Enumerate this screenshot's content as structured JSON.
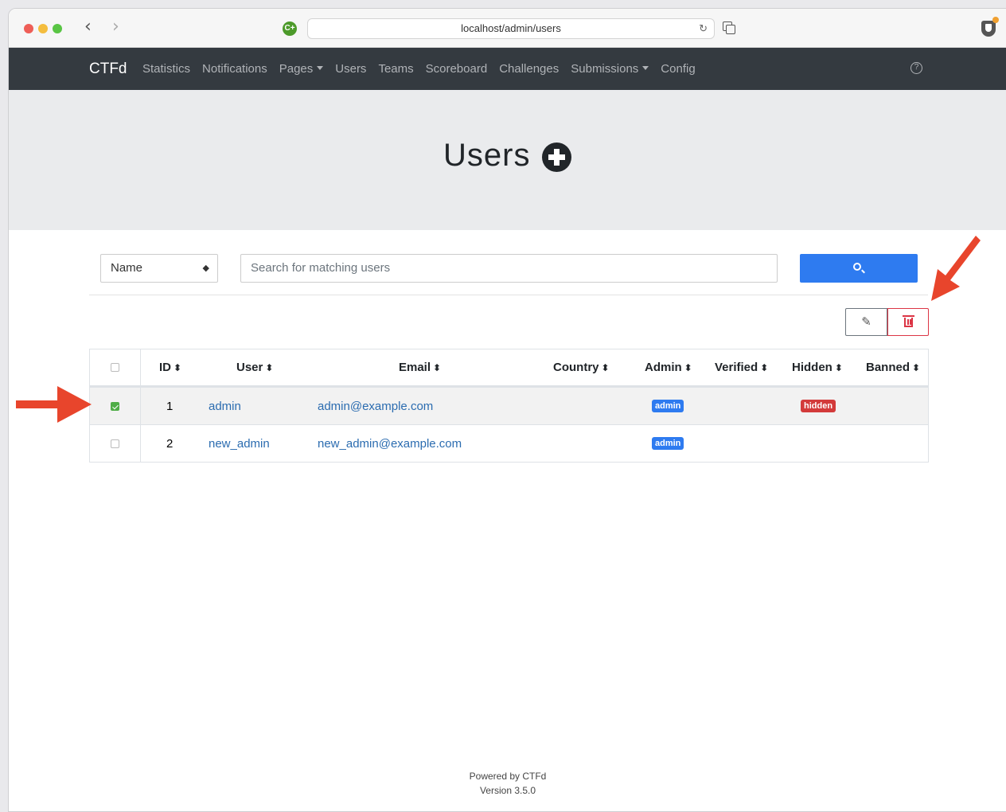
{
  "browser": {
    "url": "localhost/admin/users",
    "extension_label": "C+"
  },
  "navbar": {
    "brand": "CTFd",
    "items": [
      {
        "label": "Statistics"
      },
      {
        "label": "Notifications"
      },
      {
        "label": "Pages",
        "dropdown": true
      },
      {
        "label": "Users"
      },
      {
        "label": "Teams"
      },
      {
        "label": "Scoreboard"
      },
      {
        "label": "Challenges"
      },
      {
        "label": "Submissions",
        "dropdown": true
      },
      {
        "label": "Config"
      }
    ],
    "help_label": "?"
  },
  "page": {
    "title": "Users"
  },
  "search": {
    "field_selected": "Name",
    "placeholder": "Search for matching users"
  },
  "table": {
    "columns": [
      "ID",
      "User",
      "Email",
      "Country",
      "Admin",
      "Verified",
      "Hidden",
      "Banned"
    ],
    "rows": [
      {
        "checked": true,
        "id": "1",
        "user": "admin",
        "email": "admin@example.com",
        "country": "",
        "admin": "admin",
        "verified": "",
        "hidden": "hidden",
        "banned": ""
      },
      {
        "checked": false,
        "id": "2",
        "user": "new_admin",
        "email": "new_admin@example.com",
        "country": "",
        "admin": "admin",
        "verified": "",
        "hidden": "",
        "banned": ""
      }
    ]
  },
  "footer": {
    "line1": "Powered by CTFd",
    "line2": "Version 3.5.0"
  },
  "colors": {
    "navbar_bg": "#343a40",
    "primary": "#2e7bf0",
    "danger": "#dc3545",
    "annotation_arrow": "#e8452c"
  }
}
